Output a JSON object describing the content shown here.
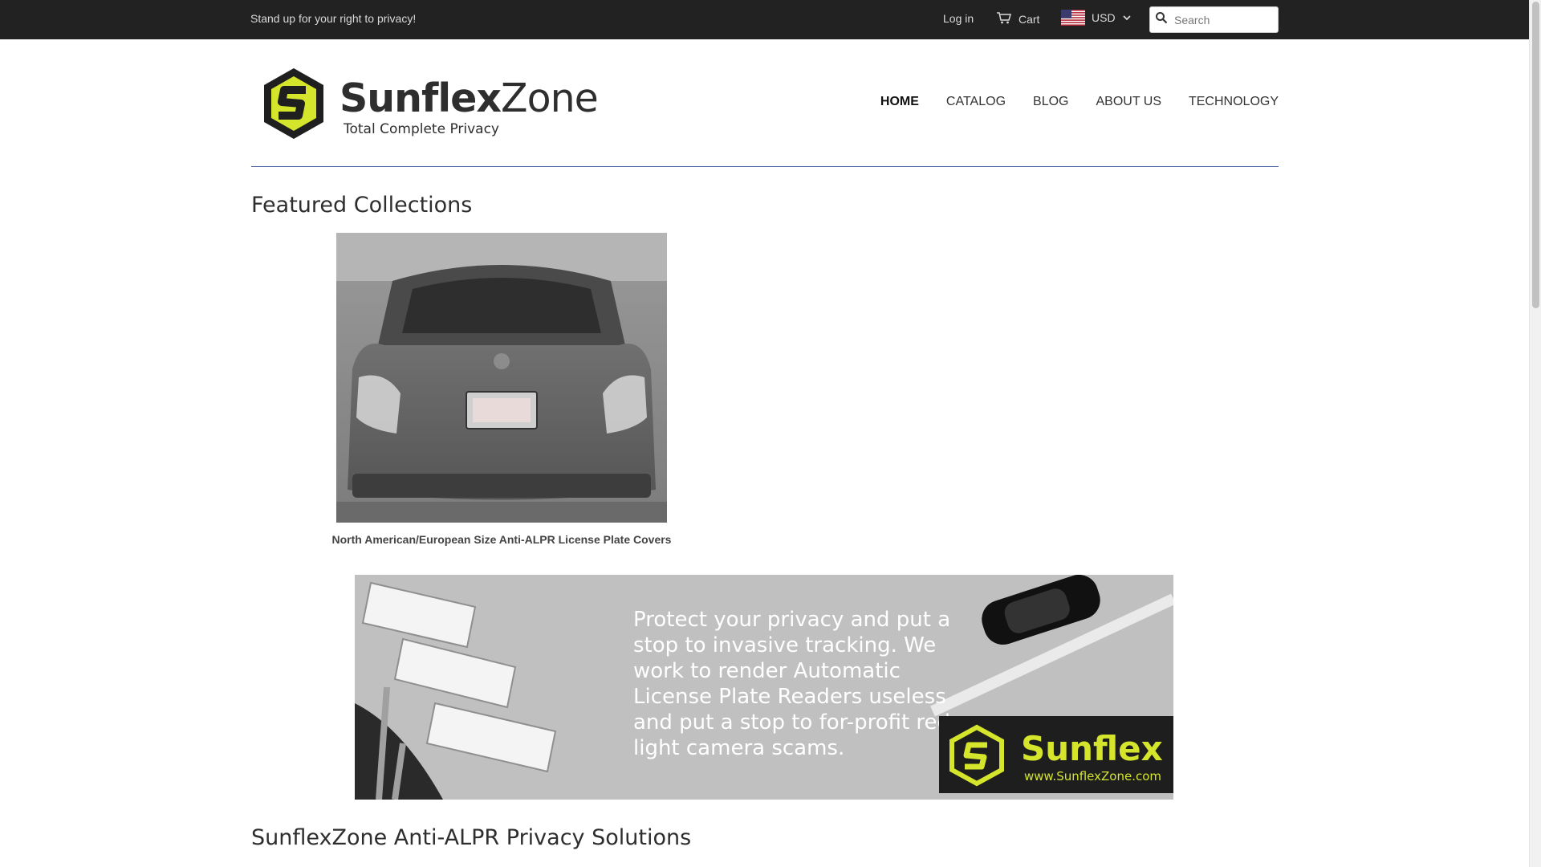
{
  "topbar": {
    "tagline": "Stand up for your right to privacy!",
    "login_label": "Log in",
    "cart_label": "Cart",
    "currency_label": "USD",
    "search_placeholder": "Search"
  },
  "header": {
    "logo_name_bold": "Sunflex",
    "logo_name_regular": "Zone",
    "logo_tagline": "Total Complete Privacy",
    "nav": [
      {
        "label": "HOME"
      },
      {
        "label": "CATALOG"
      },
      {
        "label": "BLOG"
      },
      {
        "label": "ABOUT US"
      },
      {
        "label": "TECHNOLOGY"
      }
    ]
  },
  "main": {
    "featured_title": "Featured Collections",
    "collection_label": "North American/European Size Anti-ALPR License Plate Covers",
    "banner": {
      "message": "Protect your privacy and put a stop to invasive tracking. We work to render Automatic License Plate Readers useless and put a stop to for-profit red-light camera scams.",
      "brand": "Sunflex",
      "url": "www.SunflexZone.com"
    },
    "solutions_title": "SunflexZone Anti-ALPR Privacy Solutions"
  },
  "colors": {
    "topbar": "#222222",
    "accent_line": "#4a67a6",
    "brand_yellow": "#d4e52c"
  }
}
